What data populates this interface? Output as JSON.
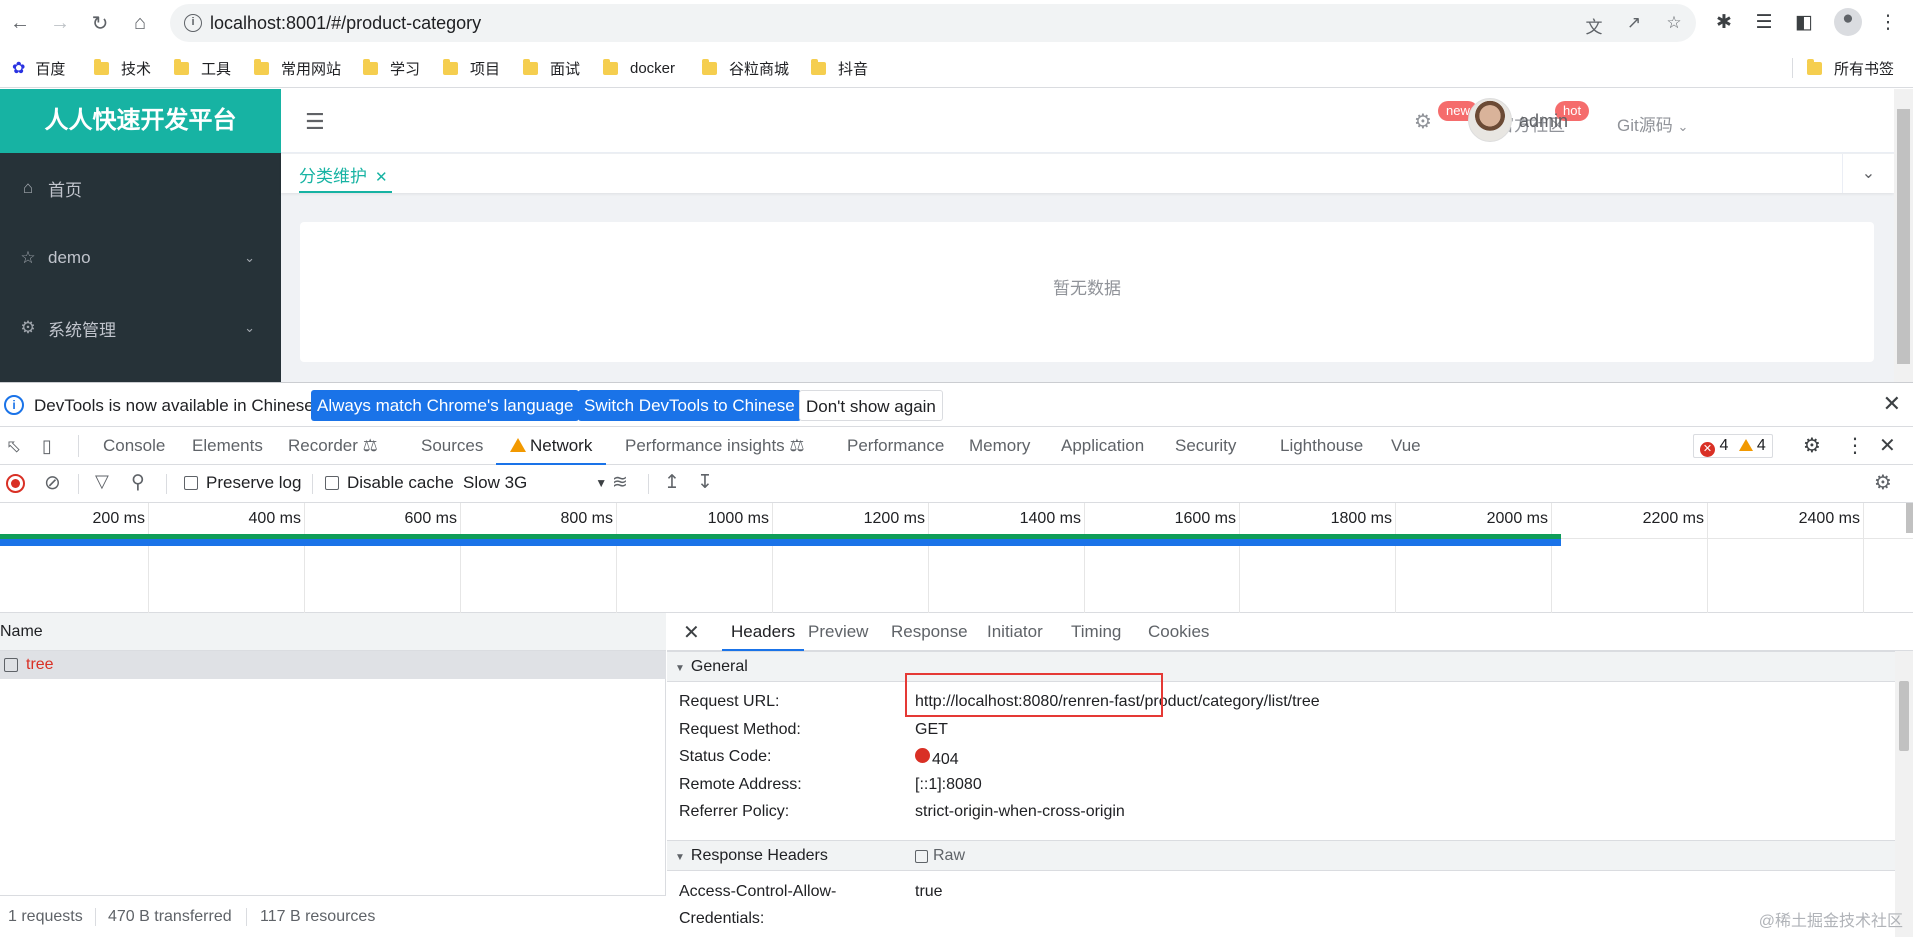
{
  "browser": {
    "url": "localhost:8001/#/product-category",
    "bookmarks": [
      "百度",
      "技术",
      "工具",
      "常用网站",
      "学习",
      "项目",
      "面试",
      "docker",
      "谷粒商城",
      "抖音"
    ],
    "all_bookmarks": "所有书签"
  },
  "app": {
    "logo": "人人快速开发平台",
    "sidebar": [
      {
        "label": "首页",
        "icon": "home-icon"
      },
      {
        "label": "demo",
        "icon": "star-icon"
      },
      {
        "label": "系统管理",
        "icon": "gear-icon"
      }
    ],
    "header": {
      "badge_new": "new",
      "community": "官方社区",
      "badge_hot": "hot",
      "git": "Git源码",
      "user": "admin"
    },
    "tabs": [
      {
        "label": "分类维护"
      }
    ],
    "empty_text": "暂无数据"
  },
  "devtools": {
    "infobar": {
      "message": "DevTools is now available in Chinese!",
      "btn_match": "Always match Chrome's language",
      "btn_switch": "Switch DevTools to Chinese",
      "btn_dont": "Don't show again"
    },
    "tabs": [
      "Console",
      "Elements",
      "Recorder",
      "Sources",
      "Network",
      "Performance insights",
      "Performance",
      "Memory",
      "Application",
      "Security",
      "Lighthouse",
      "Vue"
    ],
    "active_tab": "Network",
    "error_count": "4",
    "warning_count": "4",
    "toolbar": {
      "preserve_log": "Preserve log",
      "disable_cache": "Disable cache",
      "throttle": "Slow 3G"
    },
    "timeline_ticks": [
      "200 ms",
      "400 ms",
      "600 ms",
      "800 ms",
      "1000 ms",
      "1200 ms",
      "1400 ms",
      "1600 ms",
      "1800 ms",
      "2000 ms",
      "2200 ms",
      "2400 ms"
    ],
    "requests": {
      "header": "Name",
      "rows": [
        {
          "name": "tree"
        }
      ]
    },
    "status": {
      "requests": "1 requests",
      "transferred": "470 B transferred",
      "resources": "117 B resources"
    },
    "detail": {
      "tabs": [
        "Headers",
        "Preview",
        "Response",
        "Initiator",
        "Timing",
        "Cookies"
      ],
      "active_tab": "Headers",
      "general_title": "General",
      "general": [
        {
          "key": "Request URL:",
          "value": "http://localhost:8080/renren-fast/product/category/list/tree"
        },
        {
          "key": "Request Method:",
          "value": "GET"
        },
        {
          "key": "Status Code:",
          "value": "404"
        },
        {
          "key": "Remote Address:",
          "value": "[::1]:8080"
        },
        {
          "key": "Referrer Policy:",
          "value": "strict-origin-when-cross-origin"
        }
      ],
      "response_title": "Response Headers",
      "raw_label": "Raw",
      "response": [
        {
          "key": "Access-Control-Allow-",
          "key2": "Credentials:",
          "value": "true"
        }
      ]
    },
    "watermark": "@稀土掘金技术社区"
  },
  "colors": {
    "accent": "#17b3a3",
    "sidebar": "#263238",
    "devtools_blue": "#1a73e8",
    "error": "#d93025"
  }
}
